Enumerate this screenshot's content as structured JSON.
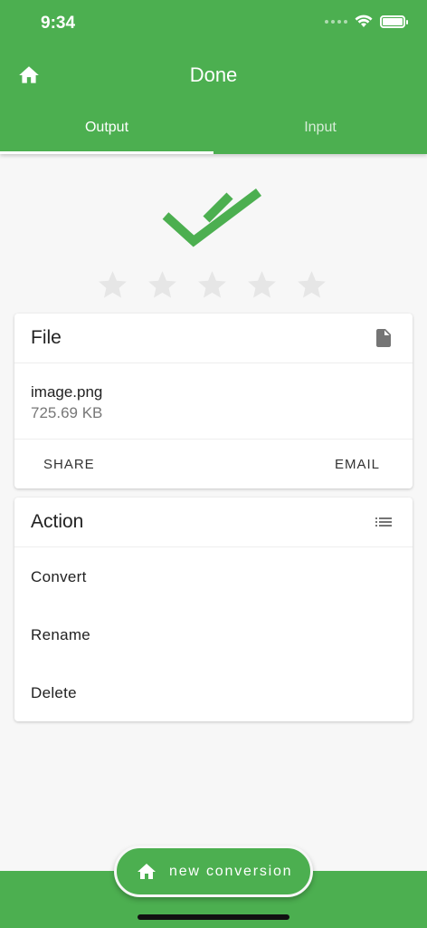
{
  "status_bar": {
    "time": "9:34"
  },
  "app_bar": {
    "title": "Done",
    "tabs": [
      {
        "label": "Output",
        "active": true
      },
      {
        "label": "Input",
        "active": false
      }
    ]
  },
  "rating": {
    "max": 5,
    "value": 0
  },
  "file_card": {
    "title": "File",
    "file_name": "image.png",
    "file_size": "725.69 KB",
    "share_label": "SHARE",
    "email_label": "EMAIL"
  },
  "action_card": {
    "title": "Action",
    "items": [
      "Convert",
      "Rename",
      "Delete"
    ]
  },
  "fab": {
    "label": "new conversion"
  },
  "colors": {
    "primary": "#4caf50",
    "background": "#f7f7f7",
    "star_empty": "#e6e6e6"
  },
  "icons": {
    "home": "home-icon",
    "file": "file-icon",
    "list": "list-icon",
    "done": "double-check-icon",
    "star": "star-icon"
  }
}
